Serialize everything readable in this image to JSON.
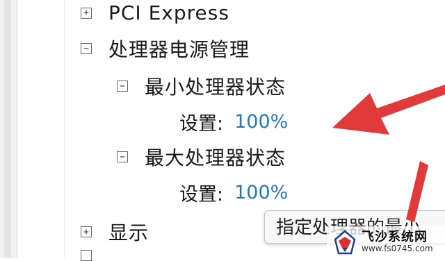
{
  "tree": {
    "pci_express": {
      "expander": "+",
      "label": "PCI Express"
    },
    "cpu_power": {
      "expander": "−",
      "label": "处理器电源管理"
    },
    "min_state": {
      "expander": "−",
      "label": "最小处理器状态",
      "setting_label": "设置:",
      "setting_value": "100%"
    },
    "max_state": {
      "expander": "−",
      "label": "最大处理器状态",
      "setting_label": "设置:",
      "setting_value": "100%"
    },
    "display": {
      "expander": "+",
      "label": "显示"
    }
  },
  "tooltip": {
    "text": "指定处理器的最小"
  },
  "watermark": {
    "name": "飞沙系统网",
    "url": "www.fs0745.com"
  },
  "colors": {
    "arrow": "#e03a3a",
    "value_blue": "#2a77b8"
  }
}
